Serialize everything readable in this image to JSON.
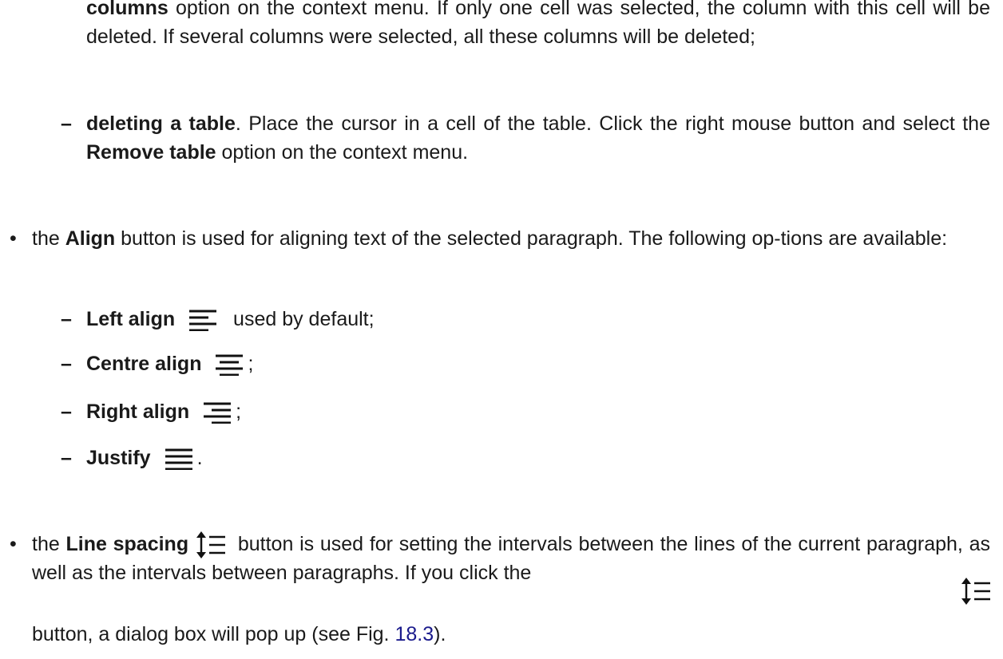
{
  "p1": {
    "bold1": "columns",
    "text1": " option on the context menu. If only one cell was selected, the column with this cell will be deleted. If several columns were selected, all these columns will be deleted;"
  },
  "delete_table": {
    "dash": "–",
    "bold1": "deleting a table",
    "text1": ". Place the cursor in a cell of the table. Click the right mouse button and select the ",
    "bold2": "Remove table",
    "text2": " option on the context menu."
  },
  "align": {
    "bullet": "•",
    "text1": "the ",
    "bold1": "Align",
    "text2": " button is used for aligning text of the selected paragraph. The following op-tions are available:",
    "options": [
      {
        "dash": "–",
        "label": "Left align",
        "icon": "align-left-icon",
        "suffix": " used by default;"
      },
      {
        "dash": "–",
        "label": "Centre align",
        "icon": "align-center-icon",
        "suffix": ";"
      },
      {
        "dash": "–",
        "label": "Right align",
        "icon": "align-right-icon",
        "suffix": ";"
      },
      {
        "dash": "–",
        "label": "Justify",
        "icon": "align-justify-icon",
        "suffix": "."
      }
    ]
  },
  "line_spacing": {
    "bullet": "•",
    "text1": "the ",
    "bold1": "Line spacing",
    "icon": "line-spacing-icon",
    "text2": " button is used for setting the intervals between the lines of the current paragraph, as well as the intervals between paragraphs. If you click the",
    "text3": "button, a dialog box will pop up (see Fig. ",
    "figure_ref": "18.3",
    "text4": ")."
  }
}
